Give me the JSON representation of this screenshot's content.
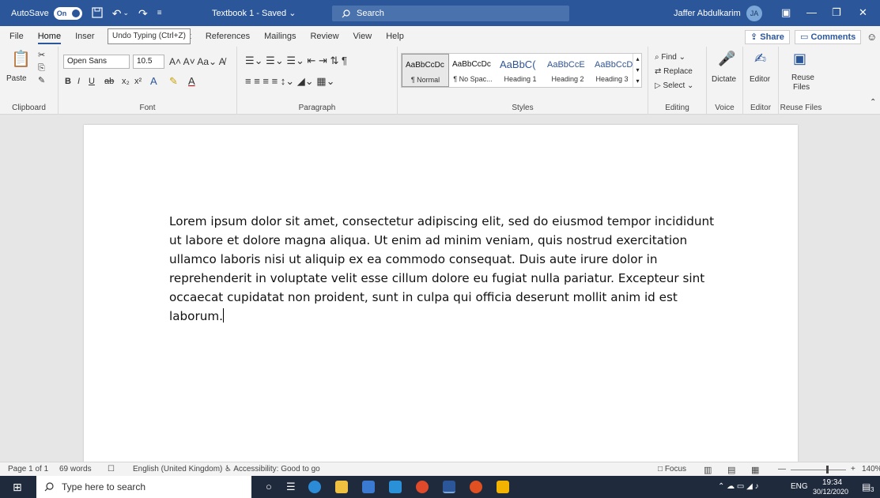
{
  "titlebar": {
    "autosave_label": "AutoSave",
    "autosave_state": "On",
    "document_title": "Textbook 1 - Saved ⌄",
    "search_label": "Search",
    "user_name": "Jaffer Abdulkarim",
    "user_initials": "JA"
  },
  "menu": {
    "tabs": [
      "File",
      "Home",
      "Inser",
      "out",
      "References",
      "Mailings",
      "Review",
      "View",
      "Help"
    ],
    "tooltip": "Undo Typing (Ctrl+Z)",
    "share_label": "Share",
    "comments_label": "Comments"
  },
  "ribbon": {
    "clipboard": {
      "paste_label": "Paste",
      "group_label": "Clipboard"
    },
    "font": {
      "font_name": "Open Sans",
      "font_size": "10.5",
      "group_label": "Font"
    },
    "paragraph": {
      "group_label": "Paragraph"
    },
    "styles": {
      "group_label": "Styles",
      "items": [
        {
          "preview": "AaBbCcDc",
          "name": "¶ Normal"
        },
        {
          "preview": "AaBbCcDc",
          "name": "¶ No Spac..."
        },
        {
          "preview": "AaBbC(",
          "name": "Heading 1"
        },
        {
          "preview": "AaBbCcE",
          "name": "Heading 2"
        },
        {
          "preview": "AaBbCcD",
          "name": "Heading 3"
        }
      ]
    },
    "editing": {
      "find": "Find",
      "replace": "Replace",
      "select": "Select",
      "group_label": "Editing"
    },
    "voice": {
      "dictate": "Dictate",
      "group_label": "Voice"
    },
    "editor": {
      "editor": "Editor",
      "group_label": "Editor"
    },
    "reuse": {
      "reuse": "Reuse",
      "files": "Files",
      "group_label": "Reuse Files"
    }
  },
  "document": {
    "body": "Lorem ipsum dolor sit amet, consectetur adipiscing elit, sed do eiusmod tempor incididunt ut labore et dolore magna aliqua. Ut enim ad minim veniam, quis nostrud exercitation ullamco laboris nisi ut aliquip ex ea commodo consequat. Duis aute irure dolor in reprehenderit in voluptate velit esse cillum dolore eu fugiat nulla pariatur. Excepteur sint occaecat cupidatat non proident, sunt in culpa qui officia deserunt mollit anim id est laborum."
  },
  "statusbar": {
    "page": "Page 1 of 1",
    "words": "69 words",
    "language": "English (United Kingdom)",
    "accessibility": "Accessibility: Good to go",
    "focus": "Focus",
    "zoom": "140%"
  },
  "taskbar": {
    "search_placeholder": "Type here to search",
    "language": "ENG",
    "time": "19:34",
    "date": "30/12/2020",
    "notification_count": "3"
  },
  "colors": {
    "word_blue": "#2b579a",
    "taskbar": "#1f2a3d"
  }
}
